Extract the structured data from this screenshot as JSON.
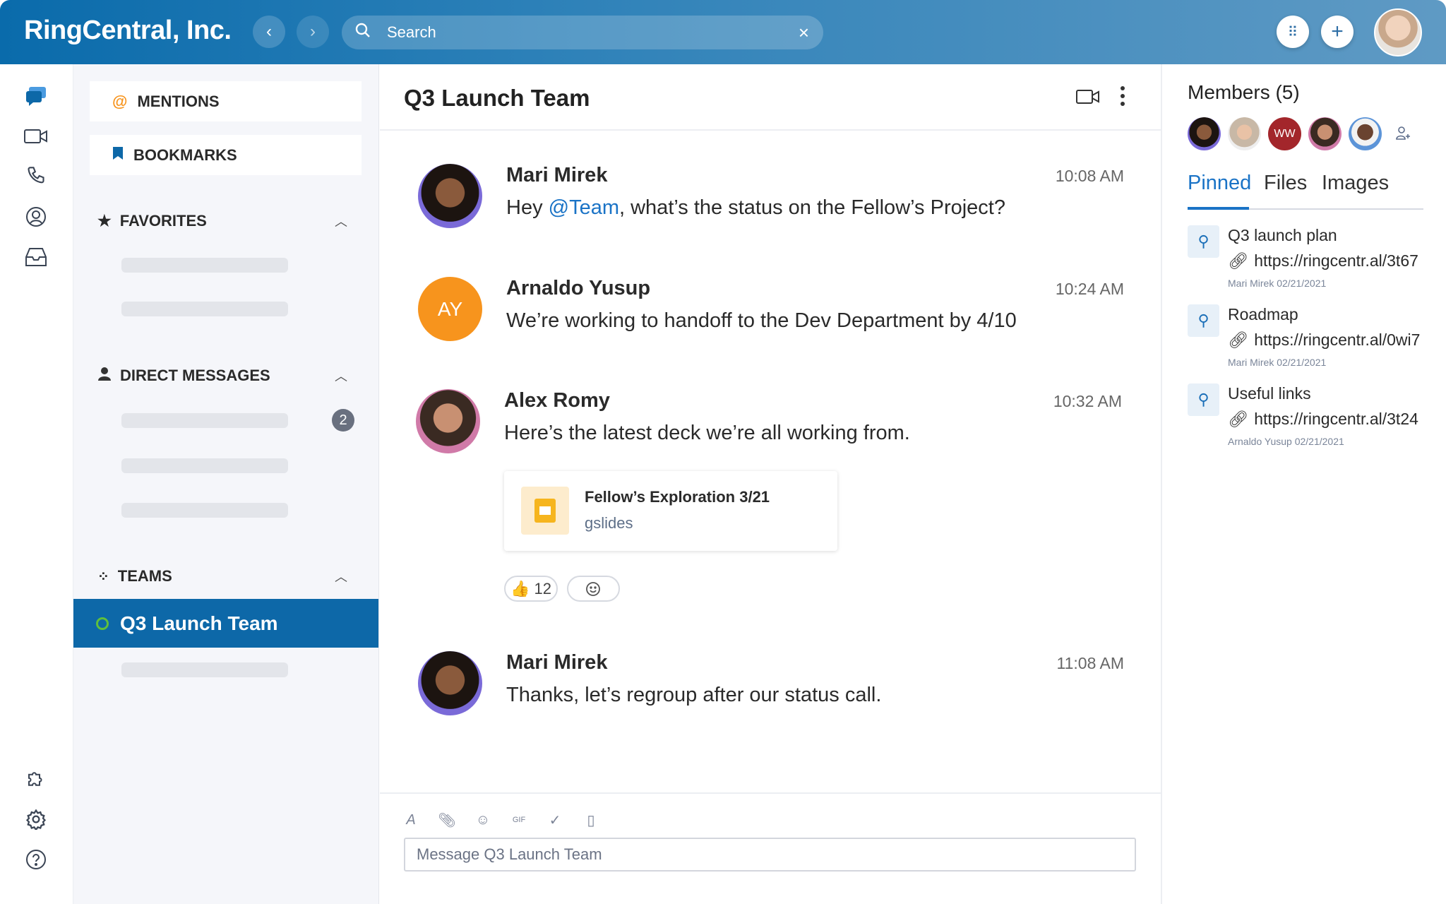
{
  "header": {
    "brand": "RingCentral, Inc.",
    "search_placeholder": "Search"
  },
  "sidebar": {
    "mentions": "MENTIONS",
    "bookmarks": "BOOKMARKS",
    "favorites": "FAVORITES",
    "direct_messages": "DIRECT MESSAGES",
    "dm_unread_badge": "2",
    "teams": "TEAMS",
    "active_team": "Q3 Launch Team"
  },
  "chat": {
    "title": "Q3 Launch Team",
    "messages": [
      {
        "author": "Mari Mirek",
        "time": "10:08 AM",
        "text_before": "Hey ",
        "mention": "@Team",
        "text_after": ", what’s the status on the Fellow’s Project?"
      },
      {
        "author": "Arnaldo Yusup",
        "initials": "AY",
        "time": "10:24 AM",
        "text": "We’re working to handoff to the Dev Department by 4/10"
      },
      {
        "author": "Alex Romy",
        "time": "10:32 AM",
        "text": "Here’s the latest deck we’re all working from.",
        "attachment": {
          "name": "Fellow’s Exploration 3/21",
          "type": "gslides"
        },
        "reactions": [
          {
            "emoji": "👍",
            "count": "12"
          }
        ]
      },
      {
        "author": "Mari Mirek",
        "time": "11:08 AM",
        "text": "Thanks, let’s regroup after our status call."
      }
    ],
    "composer_placeholder": "Message Q3 Launch Team"
  },
  "right": {
    "members_title": "Members (5)",
    "member_initials": "WW",
    "tabs": [
      "Pinned",
      "Files",
      "Images"
    ],
    "active_tab": "Pinned",
    "pinned": [
      {
        "title": "Q3 launch plan",
        "link": "https://ringcentr.al/3t67",
        "meta": "Mari Mirek 02/21/2021"
      },
      {
        "title": "Roadmap",
        "link": "https://ringcentr.al/0wi7",
        "meta": "Mari Mirek 02/21/2021"
      },
      {
        "title": "Useful links",
        "link": "https://ringcentr.al/3t24",
        "meta": "Arnaldo Yusup 02/21/2021"
      }
    ]
  },
  "colors": {
    "brand": "#0d68a8",
    "mention": "#1a73c6",
    "ay_avatar": "#f7941d",
    "ww_avatar": "#a3262b",
    "online": "#5fbf3c"
  }
}
